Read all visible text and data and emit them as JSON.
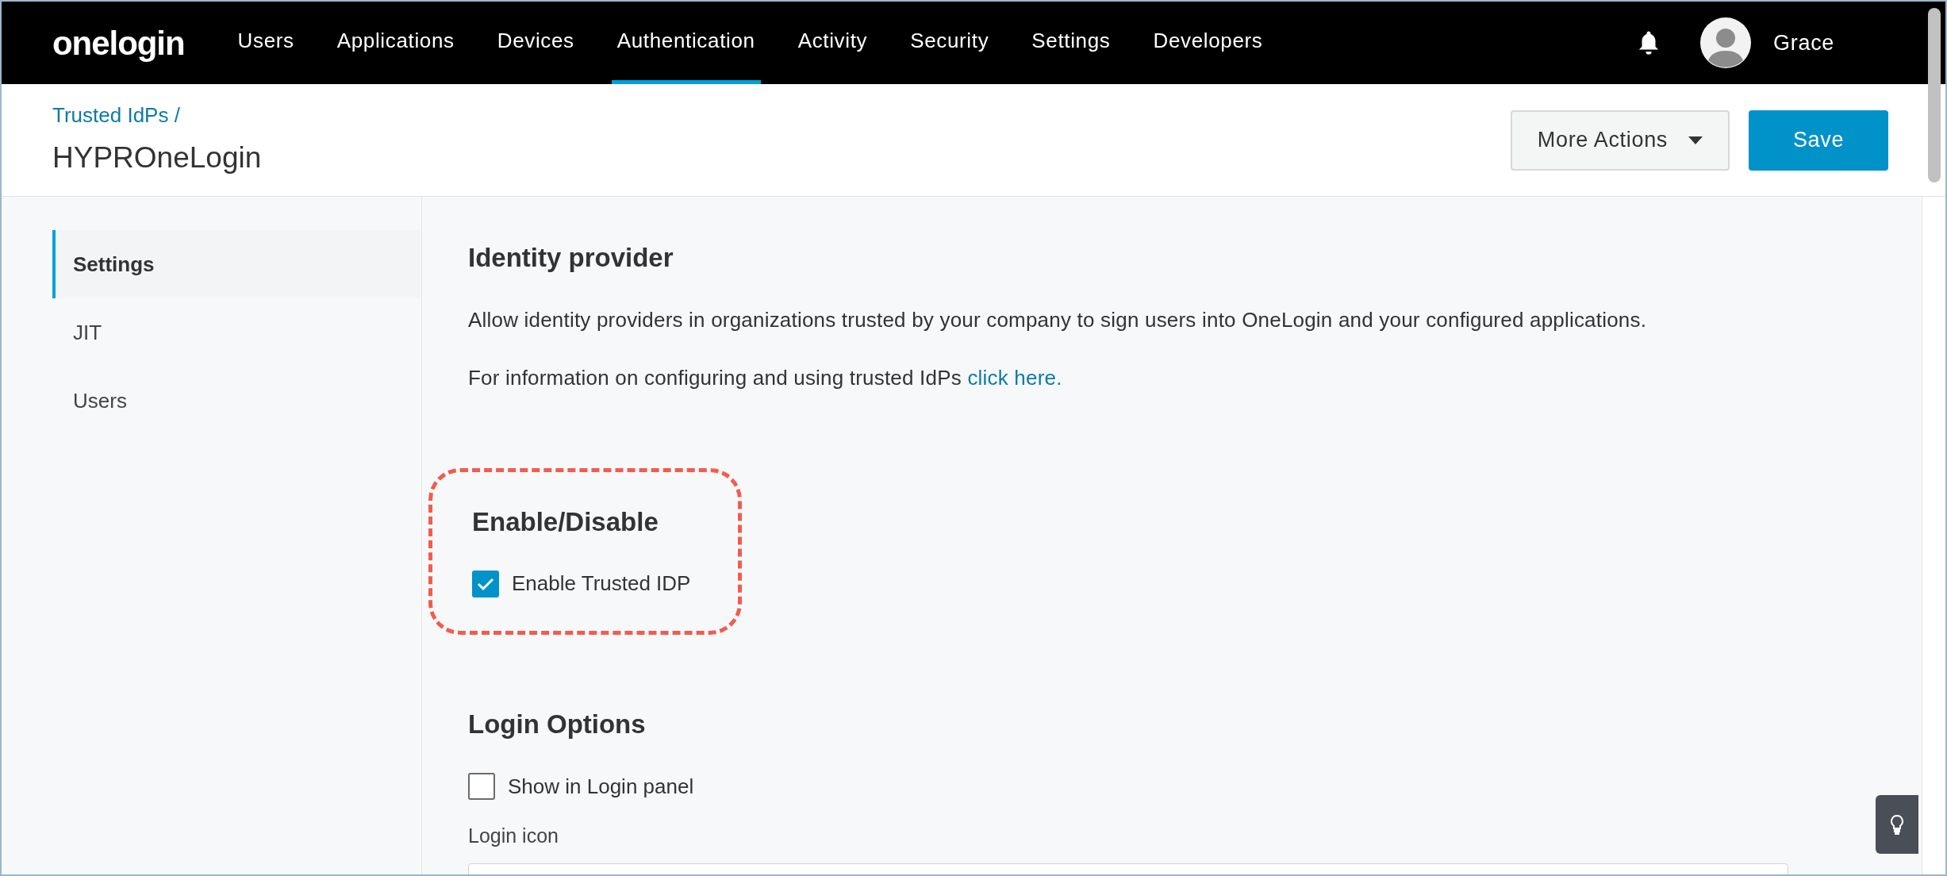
{
  "nav": {
    "logo": "onelogin",
    "items": [
      {
        "label": "Users",
        "selected": false
      },
      {
        "label": "Applications",
        "selected": false
      },
      {
        "label": "Devices",
        "selected": false
      },
      {
        "label": "Authentication",
        "selected": true
      },
      {
        "label": "Activity",
        "selected": false
      },
      {
        "label": "Security",
        "selected": false
      },
      {
        "label": "Settings",
        "selected": false
      },
      {
        "label": "Developers",
        "selected": false
      }
    ],
    "user": "Grace"
  },
  "header": {
    "breadcrumb": "Trusted IdPs /",
    "title": "HYPROneLogin",
    "buttons": [
      {
        "label": "More Actions",
        "kind": "dropdown"
      },
      {
        "label": "Save",
        "kind": "primary"
      }
    ]
  },
  "sidebar": {
    "items": [
      {
        "label": "Settings",
        "selected": true
      },
      {
        "label": "JIT",
        "selected": false
      },
      {
        "label": "Users",
        "selected": false
      }
    ]
  },
  "sections": [
    {
      "title": "Identity provider",
      "paragraphs": [
        {
          "text": "Allow identity providers in organizations trusted by your company to sign users into OneLogin and your configured applications."
        },
        {
          "text": "For information on configuring and using trusted IdPs",
          "link": "click here."
        }
      ]
    },
    {
      "title": "Enable/Disable",
      "highlighted": true,
      "checkboxes": [
        {
          "label": "Enable Trusted IDP",
          "checked": true
        }
      ]
    },
    {
      "title": "Login Options",
      "checkboxes": [
        {
          "label": "Show in Login panel",
          "checked": false
        }
      ],
      "fields": [
        {
          "label": "Login icon"
        }
      ]
    }
  ]
}
